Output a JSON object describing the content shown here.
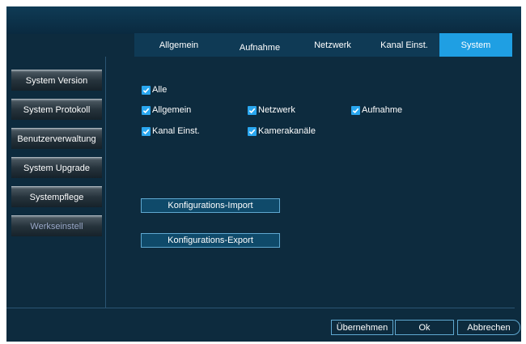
{
  "tabs": [
    {
      "label": "Allgemein"
    },
    {
      "label": "Aufnahme"
    },
    {
      "label": "Netzwerk"
    },
    {
      "label": "Kanal Einst."
    },
    {
      "label": "System",
      "active": true
    }
  ],
  "sidebar": {
    "items": [
      {
        "label": "System Version"
      },
      {
        "label": "System Protokoll"
      },
      {
        "label": "Benutzerverwaltung"
      },
      {
        "label": "System Upgrade"
      },
      {
        "label": "Systempflege"
      },
      {
        "label": "Werkseinstell",
        "disabled": true
      }
    ]
  },
  "checkboxes": {
    "alle": {
      "label": "Alle",
      "checked": true
    },
    "allgemein": {
      "label": "Allgemein",
      "checked": true
    },
    "netzwerk": {
      "label": "Netzwerk",
      "checked": true
    },
    "aufnahme": {
      "label": "Aufnahme",
      "checked": true
    },
    "kanal_einst": {
      "label": "Kanal Einst.",
      "checked": true
    },
    "kameracanaele": {
      "label": "Kamerakanäle",
      "checked": true
    }
  },
  "actions": {
    "import_label": "Konfigurations-Import",
    "export_label": "Konfigurations-Export"
  },
  "footer": {
    "apply_label": "Übernehmen",
    "ok_label": "Ok",
    "cancel_label": "Abbrechen"
  },
  "colors": {
    "background": "#0d2b3e",
    "active_tab": "#1f9fe3",
    "checkbox": "#2aa7ef"
  }
}
